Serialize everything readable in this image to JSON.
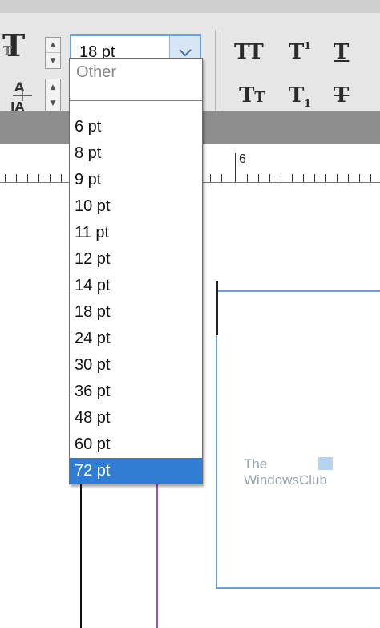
{
  "toolbar": {
    "font_size_value": "18 pt",
    "icons": {
      "font_size": "font-size-icon",
      "leading": "leading-icon",
      "all_caps": "all-caps-icon",
      "superscript": "superscript-icon",
      "underline": "underline-icon",
      "small_caps": "small-caps-icon",
      "subscript": "subscript-icon",
      "strikethrough": "strikethrough-icon"
    }
  },
  "ruler": {
    "mark_label": "6"
  },
  "dropdown": {
    "other_placeholder": "Other",
    "options": [
      "6 pt",
      "8 pt",
      "9 pt",
      "10 pt",
      "11 pt",
      "12 pt",
      "14 pt",
      "18 pt",
      "24 pt",
      "30 pt",
      "36 pt",
      "48 pt",
      "60 pt",
      "72 pt"
    ],
    "highlighted": "72 pt"
  },
  "watermark": {
    "line1": "The",
    "line2": "WindowsClub"
  },
  "colors": {
    "accent": "#2f7dd4",
    "frame": "#6b9fd6",
    "guide": "#9b4fe0"
  }
}
